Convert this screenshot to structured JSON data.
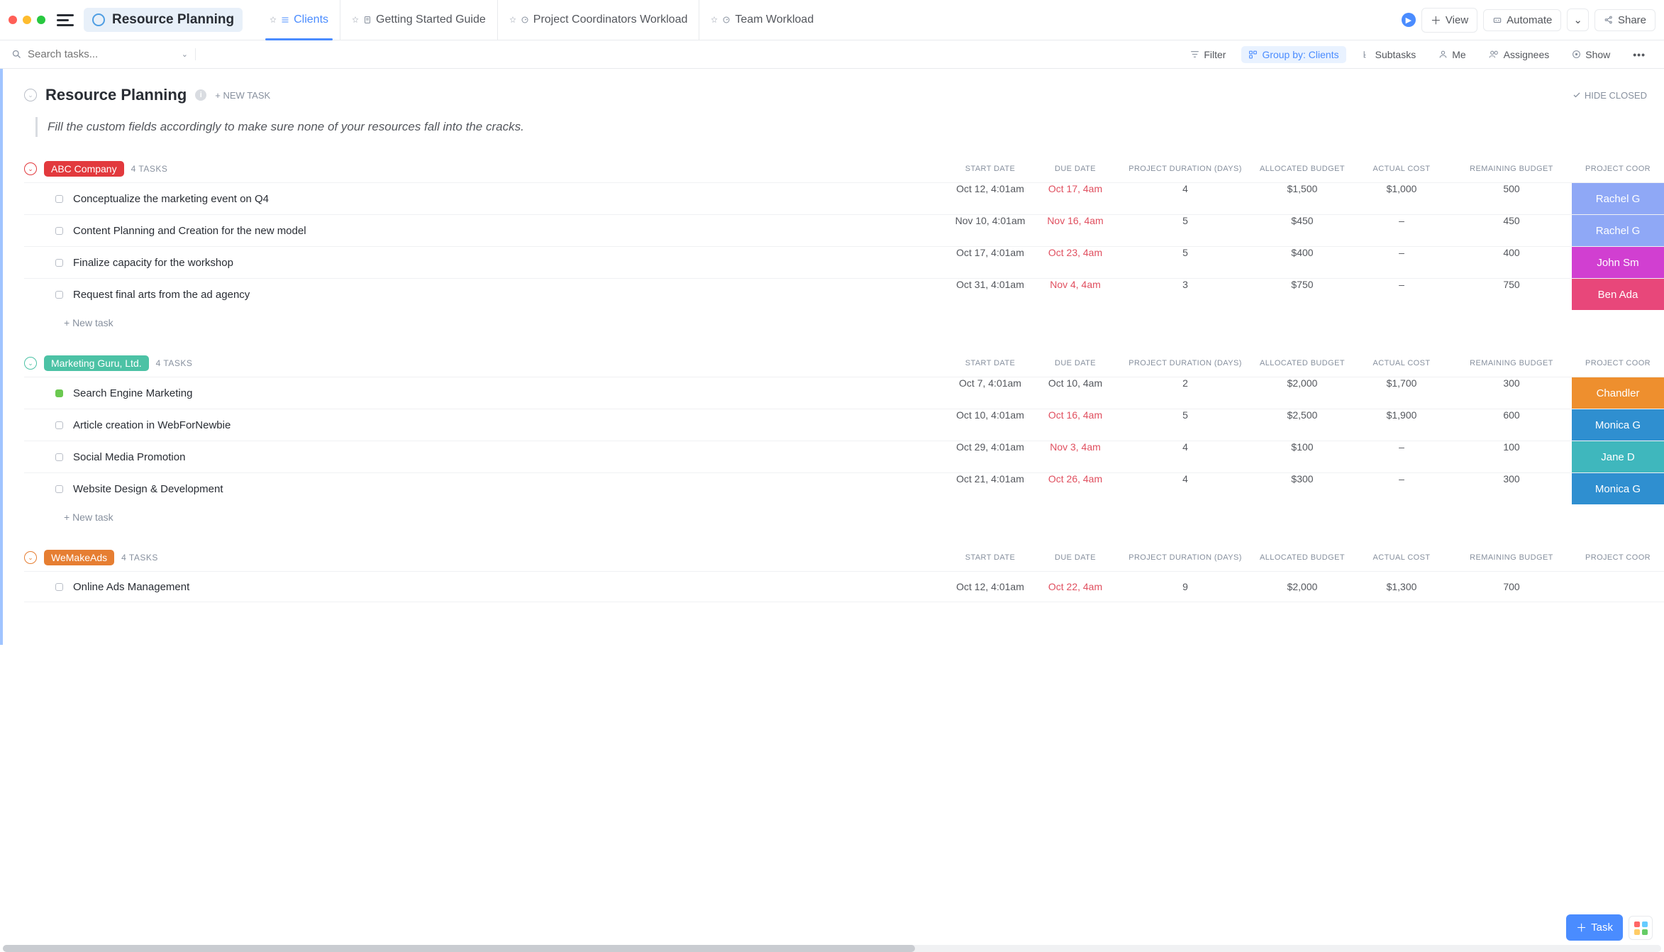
{
  "window": {
    "title": "Resource Planning"
  },
  "tabs": [
    {
      "label": "Clients",
      "active": true
    },
    {
      "label": "Getting Started Guide"
    },
    {
      "label": "Project Coordinators Workload"
    },
    {
      "label": "Team Workload"
    }
  ],
  "topbar_buttons": {
    "view": "View",
    "automate": "Automate",
    "share": "Share"
  },
  "search": {
    "placeholder": "Search tasks..."
  },
  "toolbar": {
    "filter": "Filter",
    "group_by": "Group by: Clients",
    "subtasks": "Subtasks",
    "me": "Me",
    "assignees": "Assignees",
    "show": "Show"
  },
  "section": {
    "title": "Resource Planning",
    "new_task": "+ NEW TASK",
    "hide_closed": "HIDE CLOSED",
    "description": "Fill the custom fields accordingly to make sure none of your resources fall into the cracks."
  },
  "columns": {
    "start": "START DATE",
    "due": "DUE DATE",
    "duration": "PROJECT DURATION (DAYS)",
    "allocated": "ALLOCATED BUDGET",
    "actual": "ACTUAL COST",
    "remaining": "REMAINING BUDGET",
    "coord": "PROJECT COOR"
  },
  "add_task_label": "+ New task",
  "fab": {
    "task": "Task"
  },
  "groups": [
    {
      "name": "ABC Company",
      "color": "#e2393d",
      "caret_color": "#e2393d",
      "count_label": "4 TASKS",
      "tasks": [
        {
          "name": "Conceptualize the marketing event on Q4",
          "start": "Oct 12, 4:01am",
          "due": "Oct 17, 4am",
          "overdue": true,
          "duration": "4",
          "allocated": "$1,500",
          "actual": "$1,000",
          "remaining": "500",
          "coord": "Rachel G",
          "coord_color": "#8fa8f6"
        },
        {
          "name": "Content Planning and Creation for the new model",
          "start": "Nov 10, 4:01am",
          "due": "Nov 16, 4am",
          "overdue": true,
          "duration": "5",
          "allocated": "$450",
          "actual": "–",
          "remaining": "450",
          "coord": "Rachel G",
          "coord_color": "#8fa8f6"
        },
        {
          "name": "Finalize capacity for the workshop",
          "start": "Oct 17, 4:01am",
          "due": "Oct 23, 4am",
          "overdue": true,
          "duration": "5",
          "allocated": "$400",
          "actual": "–",
          "remaining": "400",
          "coord": "John Sm",
          "coord_color": "#d13fd1"
        },
        {
          "name": "Request final arts from the ad agency",
          "start": "Oct 31, 4:01am",
          "due": "Nov 4, 4am",
          "overdue": true,
          "duration": "3",
          "allocated": "$750",
          "actual": "–",
          "remaining": "750",
          "coord": "Ben Ada",
          "coord_color": "#e8477a"
        }
      ]
    },
    {
      "name": "Marketing Guru, Ltd.",
      "color": "#4cc2a5",
      "caret_color": "#4cc2a5",
      "count_label": "4 TASKS",
      "tasks": [
        {
          "name": "Search Engine Marketing",
          "status_green": true,
          "start": "Oct 7, 4:01am",
          "due": "Oct 10, 4am",
          "overdue": false,
          "duration": "2",
          "allocated": "$2,000",
          "actual": "$1,700",
          "remaining": "300",
          "coord": "Chandler",
          "coord_color": "#ee8f2e"
        },
        {
          "name": "Article creation in WebForNewbie",
          "start": "Oct 10, 4:01am",
          "due": "Oct 16, 4am",
          "overdue": true,
          "duration": "5",
          "allocated": "$2,500",
          "actual": "$1,900",
          "remaining": "600",
          "coord": "Monica G",
          "coord_color": "#2f8fd0"
        },
        {
          "name": "Social Media Promotion",
          "start": "Oct 29, 4:01am",
          "due": "Nov 3, 4am",
          "overdue": true,
          "duration": "4",
          "allocated": "$100",
          "actual": "–",
          "remaining": "100",
          "coord": "Jane D",
          "coord_color": "#3fb7bd"
        },
        {
          "name": "Website Design & Development",
          "start": "Oct 21, 4:01am",
          "due": "Oct 26, 4am",
          "overdue": true,
          "duration": "4",
          "allocated": "$300",
          "actual": "–",
          "remaining": "300",
          "coord": "Monica G",
          "coord_color": "#2f8fd0"
        }
      ]
    },
    {
      "name": "WeMakeAds",
      "color": "#e67e32",
      "caret_color": "#e67e32",
      "count_label": "4 TASKS",
      "tasks": [
        {
          "name": "Online Ads Management",
          "start": "Oct 12, 4:01am",
          "due": "Oct 22, 4am",
          "overdue": true,
          "duration": "9",
          "allocated": "$2,000",
          "actual": "$1,300",
          "remaining": "700",
          "coord": "",
          "coord_color": ""
        }
      ],
      "partial": true
    }
  ]
}
